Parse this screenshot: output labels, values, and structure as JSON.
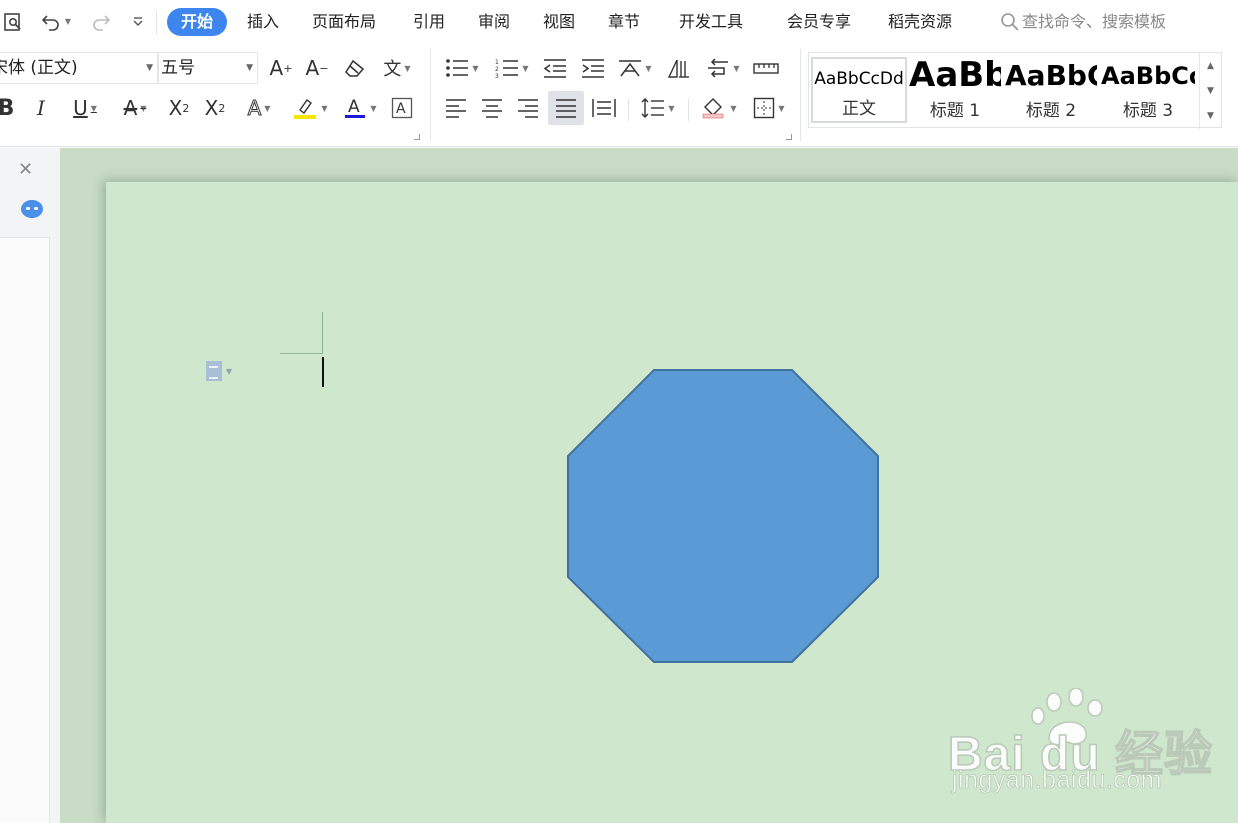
{
  "menubar": {
    "tabs": [
      "开始",
      "插入",
      "页面布局",
      "引用",
      "审阅",
      "视图",
      "章节",
      "开发工具",
      "会员专享",
      "稻壳资源"
    ],
    "active_tab": "开始",
    "search_placeholder": "查找命令、搜索模板"
  },
  "ribbon": {
    "font_name": "宋体 (正文)",
    "font_size": "五号",
    "styles": [
      {
        "preview": "AaBbCcDd",
        "name": "正文"
      },
      {
        "preview": "AaBb",
        "name": "标题 1"
      },
      {
        "preview": "AaBbC",
        "name": "标题 2"
      },
      {
        "preview": "AaBbCc",
        "name": "标题 3"
      }
    ]
  },
  "document": {
    "shape": "octagon",
    "shape_fill": "#5b9bd5",
    "shape_stroke": "#41719c",
    "page_color": "#cfe7cc"
  },
  "watermark": {
    "brand": "Bai du 经验",
    "url": "jingyan.baidu.com"
  },
  "colors": {
    "accent": "#3d86ef",
    "highlight": "#f5e600",
    "font_color": "#1a1adf"
  }
}
